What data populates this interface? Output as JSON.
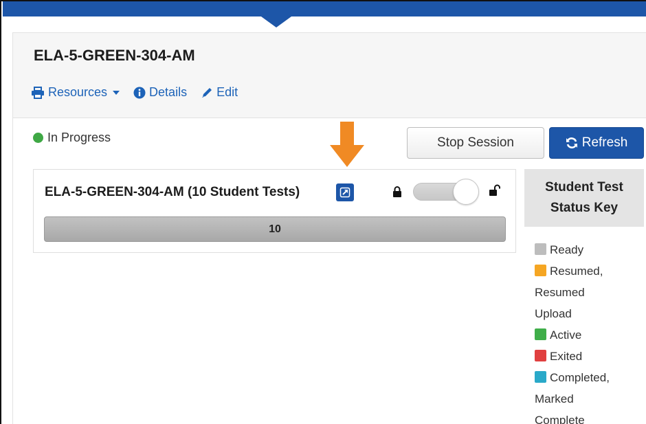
{
  "session": {
    "title": "ELA-5-GREEN-304-AM",
    "links": {
      "resources": "Resources",
      "details": "Details",
      "edit": "Edit"
    },
    "status": "In Progress",
    "status_color": "#3fa845"
  },
  "buttons": {
    "stop": "Stop Session",
    "refresh": "Refresh"
  },
  "test_group": {
    "title": "ELA-5-GREEN-304-AM (10 Student Tests)",
    "progress_count": "10",
    "lock_toggle_state": "unlocked"
  },
  "status_key": {
    "title_line1": "Student Test",
    "title_line2": "Status Key",
    "items": [
      {
        "line1": "Ready",
        "line2": "",
        "line3": "",
        "color": "#bdbdbd"
      },
      {
        "line1": "Resumed,",
        "line2": "Resumed",
        "line3": "Upload",
        "color": "#f5a623"
      },
      {
        "line1": "Active",
        "line2": "",
        "line3": "",
        "color": "#3fae49"
      },
      {
        "line1": "Exited",
        "line2": "",
        "line3": "",
        "color": "#e04040"
      },
      {
        "line1": "Completed,",
        "line2": "Marked",
        "line3": "Complete",
        "color": "#2aa9c9"
      }
    ]
  },
  "colors": {
    "brand": "#1d56a8",
    "link": "#1d63b8",
    "annotation_arrow": "#f08a24"
  }
}
